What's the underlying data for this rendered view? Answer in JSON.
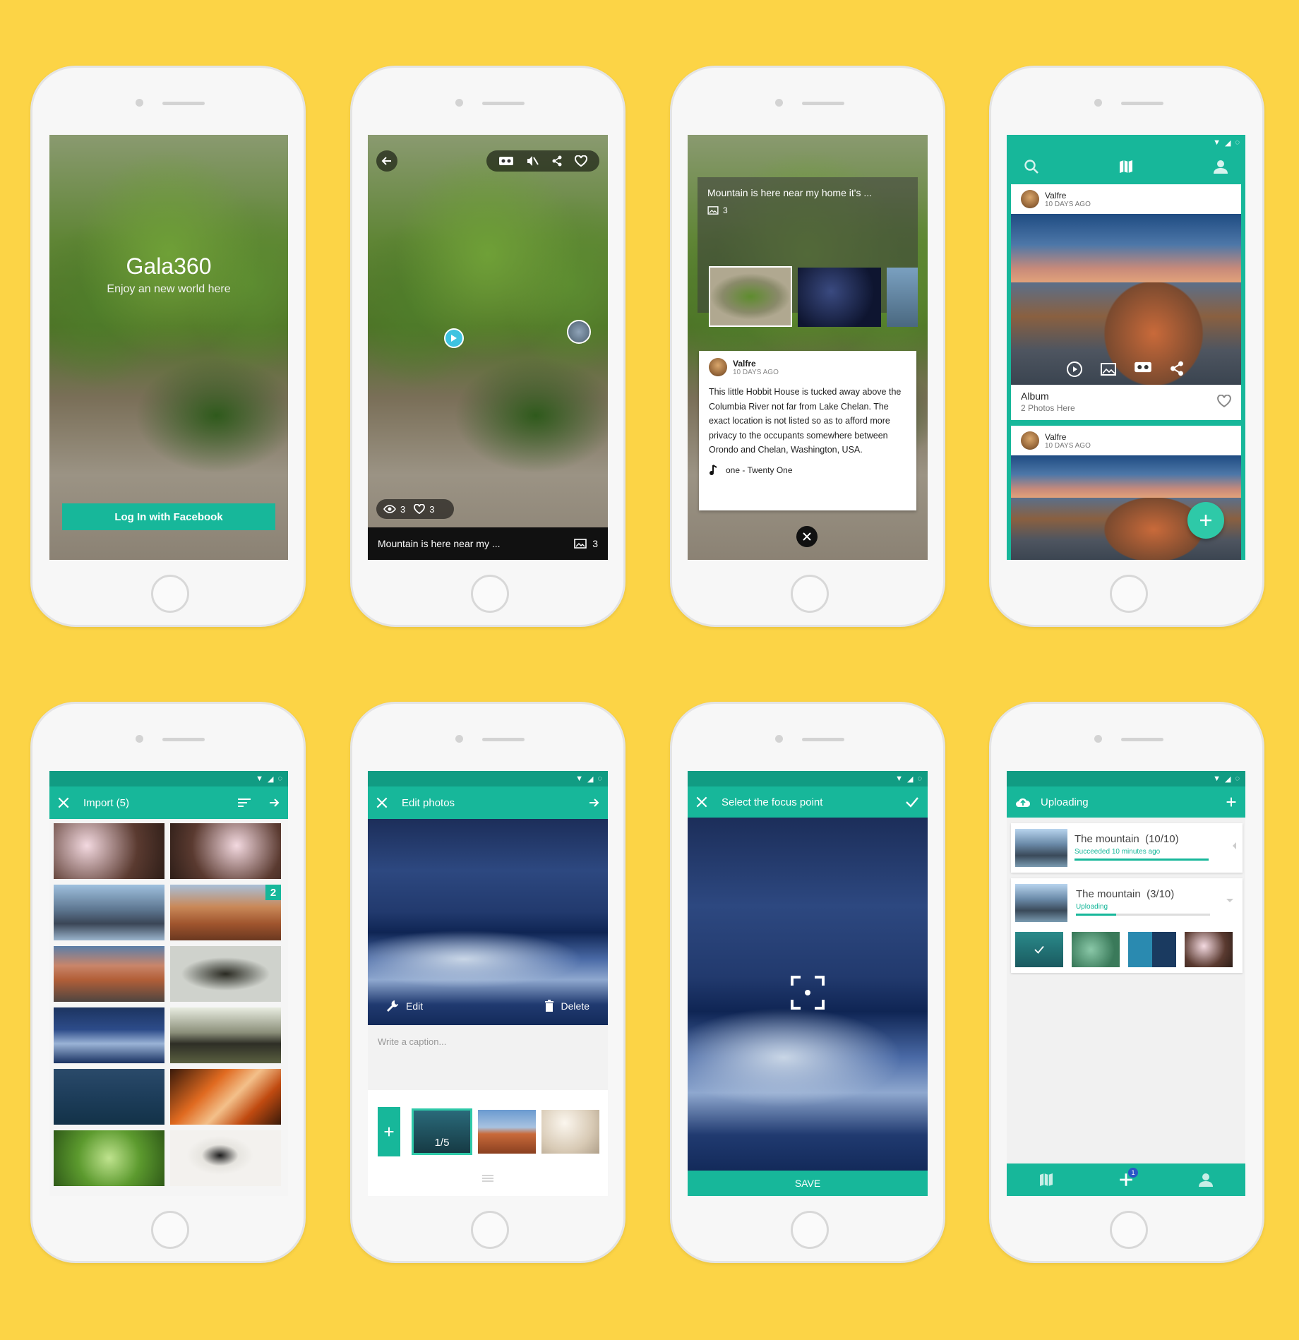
{
  "colors": {
    "background": "#FCD446",
    "teal": "#17B79A",
    "dark_teal": "#119C83"
  },
  "login": {
    "app_name": "Gala360",
    "tagline": "Enjoy an new world here",
    "button": "Log In with Facebook"
  },
  "viewer": {
    "views": "3",
    "likes": "3",
    "caption": "Mountain is here near my ...",
    "album_count": "3",
    "icons": [
      "back-icon",
      "vr-icon",
      "mute-icon",
      "share-icon",
      "heart-icon"
    ]
  },
  "detail": {
    "title": "Mountain is here near my home it's ...",
    "photo_count": "3",
    "user": "Valfre",
    "time": "10 DAYS AGO",
    "description": "This little Hobbit House is tucked away above the Columbia River not far from Lake Chelan. The exact location is not listed so as to afford more privacy to the occupants somewhere between Orondo and Chelan, Washington, USA.",
    "music": "one - Twenty One"
  },
  "feed": {
    "posts": [
      {
        "user": "Valfre",
        "time": "10 DAYS AGO",
        "album_title": "Album",
        "album_sub": "2 Photos Here"
      },
      {
        "user": "Valfre",
        "time": "10 DAYS AGO"
      }
    ]
  },
  "import": {
    "title": "Import (5)",
    "badge": "2"
  },
  "edit": {
    "title": "Edit photos",
    "edit": "Edit",
    "delete": "Delete",
    "caption_placeholder": "Write a caption...",
    "counter": "1/5"
  },
  "focus": {
    "title": "Select the focus point",
    "save": "SAVE"
  },
  "upload": {
    "title": "Uploading",
    "items": [
      {
        "name": "The mountain",
        "count": "(10/10)",
        "status": "Succeeded 10 minutes ago",
        "progress": 1.0
      },
      {
        "name": "The mountain",
        "count": "(3/10)",
        "status": "Uploading",
        "progress": 0.3
      }
    ],
    "nav_badge": "1"
  }
}
